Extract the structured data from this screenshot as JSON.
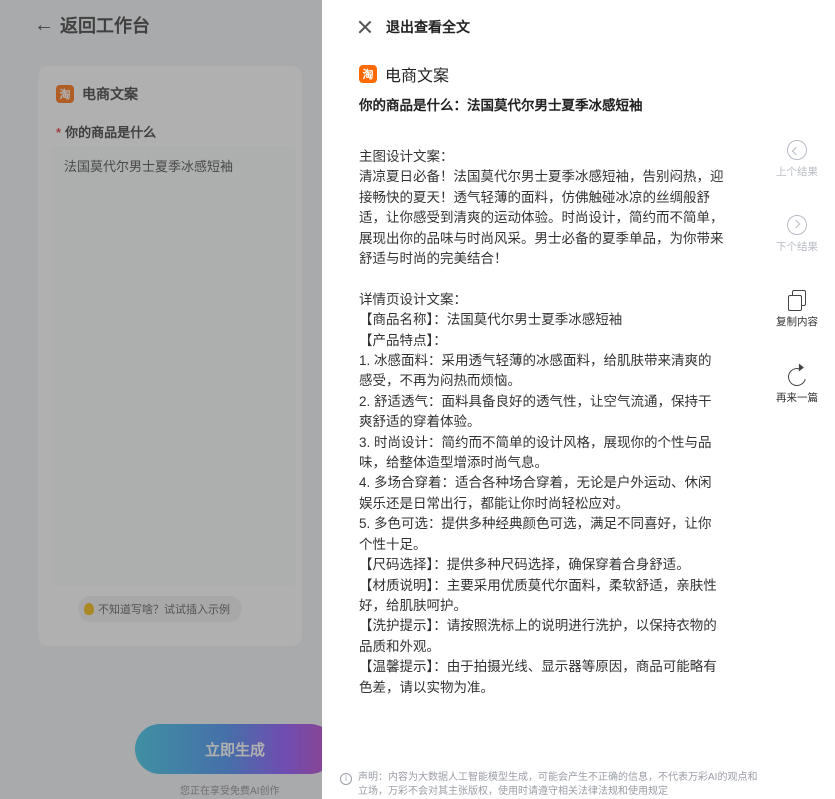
{
  "background": {
    "back_label": "返回工作台",
    "card_title": "电商文案",
    "taobao_logo": "淘",
    "field_label": "你的商品是什么",
    "field_value": "法国莫代尔男士夏季冰感短袖",
    "hint": "不知道写啥？试试插入示例",
    "generate_label": "立即生成",
    "generate_note": "您正在享受免费AI创作"
  },
  "drawer": {
    "exit_label": "退出查看全文",
    "title": "电商文案",
    "question": "你的商品是什么：法国莫代尔男士夏季冰感短袖",
    "article": [
      "主图设计文案：",
      "清凉夏日必备！法国莫代尔男士夏季冰感短袖，告别闷热，迎接畅快的夏天！透气轻薄的面料，仿佛触碰冰凉的丝绸般舒适，让你感受到清爽的运动体验。时尚设计，简约而不简单，展现出你的品味与时尚风采。男士必备的夏季单品，为你带来舒适与时尚的完美结合！",
      "",
      "详情页设计文案：",
      "【商品名称】：法国莫代尔男士夏季冰感短袖",
      "【产品特点】：",
      "1. 冰感面料：采用透气轻薄的冰感面料，给肌肤带来清爽的感受，不再为闷热而烦恼。",
      "2. 舒适透气：面料具备良好的透气性，让空气流通，保持干爽舒适的穿着体验。",
      "3. 时尚设计：简约而不简单的设计风格，展现你的个性与品味，给整体造型增添时尚气息。",
      "4. 多场合穿着：适合各种场合穿着，无论是户外运动、休闲娱乐还是日常出行，都能让你时尚轻松应对。",
      "5. 多色可选：提供多种经典颜色可选，满足不同喜好，让你个性十足。",
      "【尺码选择】：提供多种尺码选择，确保穿着合身舒适。",
      "【材质说明】：主要采用优质莫代尔面料，柔软舒适，亲肤性好，给肌肤呵护。",
      "【洗护提示】：请按照洗标上的说明进行洗护，以保持衣物的品质和外观。",
      "【温馨提示】：由于拍摄光线、显示器等原因，商品可能略有色差，请以实物为准。"
    ],
    "tools": {
      "prev": "上个结果",
      "next": "下个结果",
      "copy": "复制内容",
      "regen": "再来一篇"
    },
    "disclaimer": "声明：内容为大数据人工智能模型生成，可能会产生不正确的信息，不代表万彩AI的观点和立场，万彩不会对其主张版权，使用时请遵守相关法律法规和使用规定"
  }
}
